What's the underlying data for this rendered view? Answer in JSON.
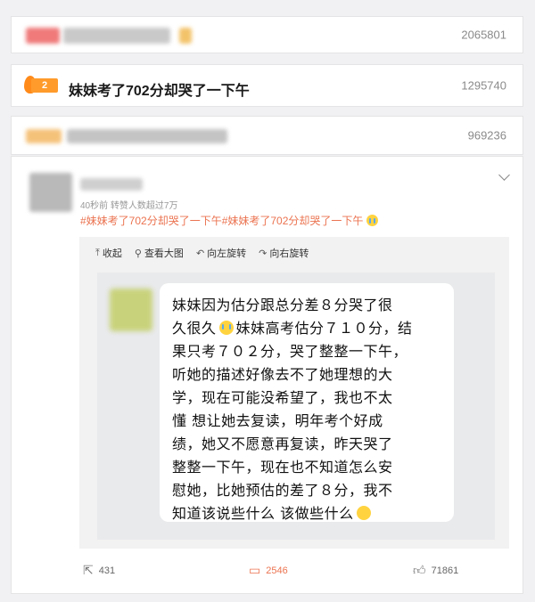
{
  "hot_list": [
    {
      "rank": "",
      "title": "",
      "count": "2065801"
    },
    {
      "rank": "2",
      "title": "妹妹考了702分却哭了一下午",
      "count": "1295740"
    },
    {
      "rank": "",
      "title": "",
      "count": "969236"
    }
  ],
  "post": {
    "meta": "40秒前  转赞人数超过7万",
    "tags": [
      "#妹妹考了702分却哭了一下午#",
      "妹妹考了702分却哭了一下午"
    ],
    "toolbar": {
      "collapse": "收起",
      "view_large": "查看大图",
      "rotate_left": "向左旋转",
      "rotate_right": "向右旋转"
    },
    "image_text_lines": [
      "妹妹因为估分跟总分差８分哭了很",
      "久很久",
      "妹妹高考估分７１０分，结",
      "果只考７０２分，哭了整整一下午，",
      "听她的描述好像去不了她理想的大",
      "学，现在可能没希望了，我也不太",
      "懂 想让她去复读，明年考个好成",
      "绩，她又不愿意再复读，昨天哭了",
      "整整一下午，现在也不知道怎么安",
      "慰她，比她预估的差了８分，我不",
      "知道该说些什么 该做些什么"
    ],
    "actions": {
      "repost": "431",
      "comment": "2546",
      "like": "71861"
    }
  },
  "icons": {
    "crying_emoji": "crying-face-icon",
    "shy_emoji": "grimace-face-icon",
    "chevron": "chevron-down-icon"
  },
  "colors": {
    "accent": "#eb7350",
    "hot_badge": "#ff9b2b"
  }
}
